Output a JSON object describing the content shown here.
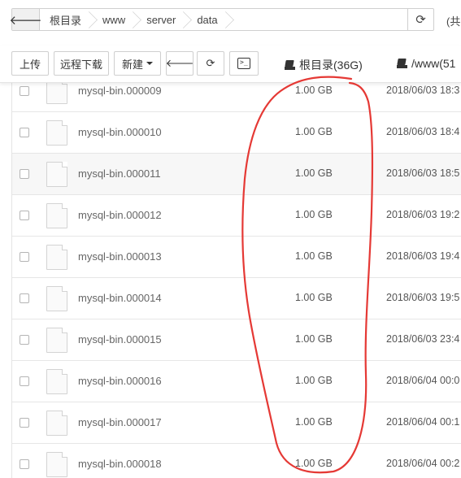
{
  "breadcrumb": {
    "items": [
      "根目录",
      "www",
      "server",
      "data"
    ],
    "extra_text": "(共"
  },
  "toolbar": {
    "upload_label": "上传",
    "remote_download_label": "远程下载",
    "new_label": "新建",
    "disks": [
      {
        "label": "根目录(36G)"
      },
      {
        "label": "/www(51"
      }
    ]
  },
  "files": [
    {
      "name": "mysql-bin.000009",
      "size": "1.00 GB",
      "date": "2018/06/03 18:3"
    },
    {
      "name": "mysql-bin.000010",
      "size": "1.00 GB",
      "date": "2018/06/03 18:4"
    },
    {
      "name": "mysql-bin.000011",
      "size": "1.00 GB",
      "date": "2018/06/03 18:5"
    },
    {
      "name": "mysql-bin.000012",
      "size": "1.00 GB",
      "date": "2018/06/03 19:2"
    },
    {
      "name": "mysql-bin.000013",
      "size": "1.00 GB",
      "date": "2018/06/03 19:4"
    },
    {
      "name": "mysql-bin.000014",
      "size": "1.00 GB",
      "date": "2018/06/03 19:5"
    },
    {
      "name": "mysql-bin.000015",
      "size": "1.00 GB",
      "date": "2018/06/03 23:4"
    },
    {
      "name": "mysql-bin.000016",
      "size": "1.00 GB",
      "date": "2018/06/04 00:0"
    },
    {
      "name": "mysql-bin.000017",
      "size": "1.00 GB",
      "date": "2018/06/04 00:1"
    },
    {
      "name": "mysql-bin.000018",
      "size": "1.00 GB",
      "date": "2018/06/04 00:2"
    }
  ],
  "annotation": {
    "color": "#e53935"
  }
}
